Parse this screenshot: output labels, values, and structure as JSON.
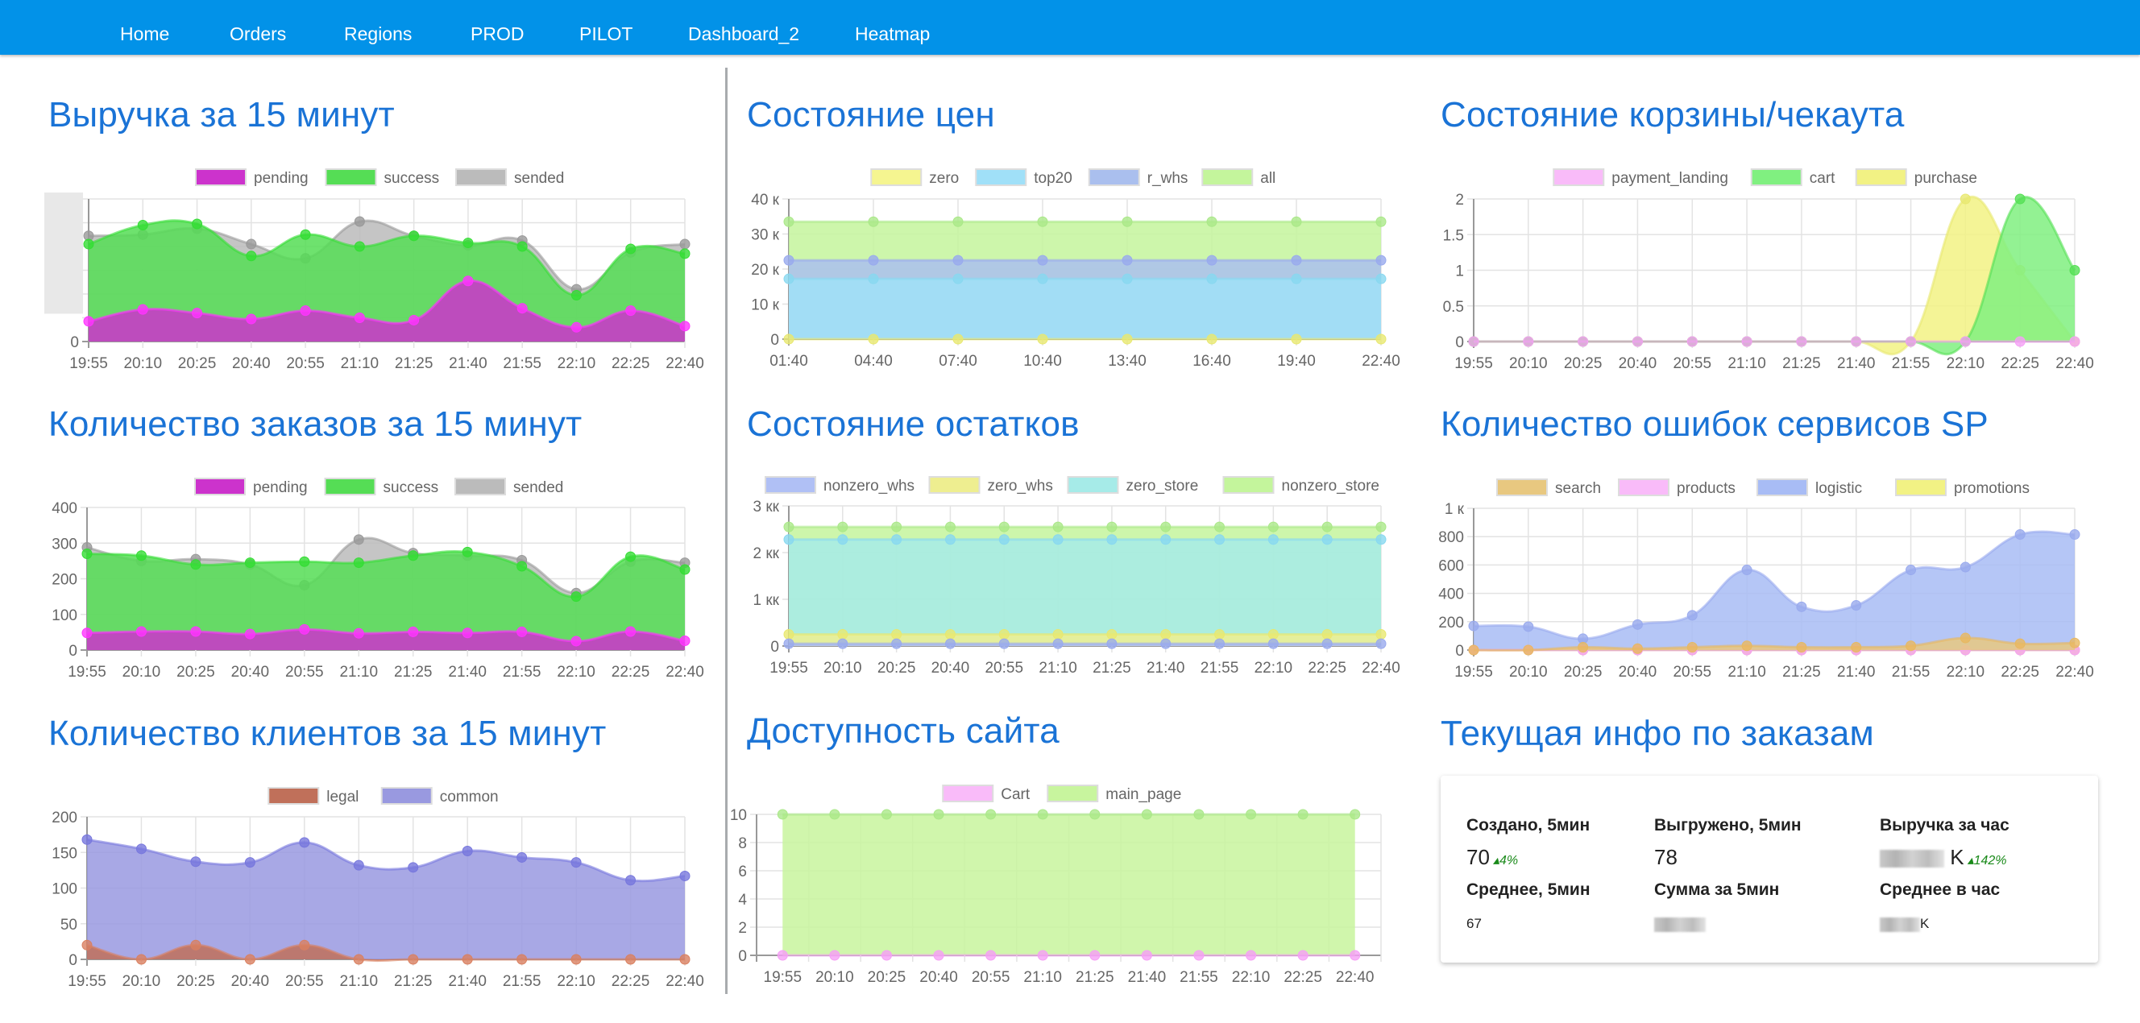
{
  "nav": {
    "items": [
      "Home",
      "Orders",
      "Regions",
      "PROD",
      "PILOT",
      "Dashboard_2",
      "Heatmap"
    ],
    "color": "#0292e8"
  },
  "titles": {
    "revenue": "Выручка за 15 минут",
    "orders": "Количество заказов за 15 минут",
    "clients": "Количество клиентов за 15 минут",
    "prices": "Состояние цен",
    "stocks": "Состояние остатков",
    "availability": "Доступность сайта",
    "cart": "Состояние корзины/чекаута",
    "errors": "Количество ошибок сервисов SP",
    "info": "Текущая инфо по заказам"
  },
  "info_card": {
    "created_label": "Создано, 5мин",
    "created_value": "70",
    "created_delta": "4%",
    "unloaded_label": "Выгружено, 5мин",
    "unloaded_value": "78",
    "revenue_hour_label": "Выручка за час",
    "revenue_hour_value_suffix": "K",
    "revenue_hour_delta": "142%",
    "avg5_label": "Среднее, 5мин",
    "avg5_value": "67",
    "sum5_label": "Сумма за 5мин",
    "avg_hour_label": "Среднее в час",
    "avg_hour_value_suffix": "K",
    "delta_color": "#1a8a1a"
  },
  "chart_data": [
    {
      "id": "revenue",
      "type": "area",
      "title": "Выручка за 15 минут",
      "categories": [
        "19:55",
        "20:10",
        "20:25",
        "20:40",
        "20:55",
        "21:10",
        "21:25",
        "21:40",
        "21:55",
        "22:10",
        "22:25",
        "22:40"
      ],
      "ylim": [
        0,
        6
      ],
      "yticks": [
        "0"
      ],
      "yticks_hidden": true,
      "grid": true,
      "legend": "top",
      "note": "y tick labels blurred; values in gridline units",
      "series": [
        {
          "name": "pending",
          "color": "#ff33ff",
          "fill": "#cc33cc",
          "values": [
            0.85,
            1.35,
            1.2,
            0.95,
            1.3,
            1.0,
            0.9,
            2.55,
            1.4,
            0.6,
            1.3,
            0.65
          ]
        },
        {
          "name": "success",
          "color": "#33dd33",
          "fill": "#55dd55",
          "values": [
            4.1,
            4.9,
            4.95,
            3.6,
            4.5,
            4.0,
            4.45,
            4.15,
            4.0,
            1.95,
            3.9,
            3.7
          ]
        },
        {
          "name": "sended",
          "color": "#999999",
          "fill": "#bbbbbb",
          "values": [
            4.45,
            4.5,
            4.75,
            4.1,
            3.5,
            5.05,
            4.45,
            4.05,
            4.25,
            2.2,
            3.75,
            4.1
          ]
        }
      ]
    },
    {
      "id": "orders",
      "type": "area",
      "title": "Количество заказов за 15 минут",
      "categories": [
        "19:55",
        "20:10",
        "20:25",
        "20:40",
        "20:55",
        "21:10",
        "21:25",
        "21:40",
        "21:55",
        "22:10",
        "22:25",
        "22:40"
      ],
      "ylim": [
        0,
        400
      ],
      "yticks": [
        "0",
        "100",
        "200",
        "300",
        "400"
      ],
      "grid": true,
      "legend": "top",
      "series": [
        {
          "name": "pending",
          "color": "#ff33ff",
          "fill": "#cc33cc",
          "values": [
            48,
            52,
            52,
            45,
            58,
            47,
            51,
            48,
            51,
            25,
            52,
            26
          ]
        },
        {
          "name": "success",
          "color": "#33dd33",
          "fill": "#55dd55",
          "values": [
            270,
            265,
            240,
            245,
            248,
            245,
            265,
            275,
            235,
            150,
            262,
            226
          ]
        },
        {
          "name": "sended",
          "color": "#999999",
          "fill": "#bbbbbb",
          "values": [
            288,
            250,
            255,
            240,
            182,
            310,
            272,
            265,
            252,
            160,
            248,
            245
          ]
        }
      ]
    },
    {
      "id": "clients",
      "type": "area",
      "title": "Количество клиентов за 15 минут",
      "categories": [
        "19:55",
        "20:10",
        "20:25",
        "20:40",
        "20:55",
        "21:10",
        "21:25",
        "21:40",
        "21:55",
        "22:10",
        "22:25",
        "22:40"
      ],
      "ylim": [
        0,
        200
      ],
      "yticks": [
        "0",
        "50",
        "100",
        "150",
        "200"
      ],
      "grid": true,
      "legend": "top",
      "series": [
        {
          "name": "legal",
          "color": "#d98060",
          "fill": "#c0705a",
          "values": [
            20,
            0,
            20,
            0,
            20,
            0,
            0,
            0,
            0,
            0,
            0,
            0
          ]
        },
        {
          "name": "common",
          "color": "#7777dd",
          "fill": "#9999e0",
          "values": [
            168,
            155,
            137,
            136,
            164,
            132,
            129,
            152,
            143,
            136,
            111,
            117
          ]
        }
      ]
    },
    {
      "id": "prices",
      "type": "area",
      "title": "Состояние цен",
      "categories": [
        "01:40",
        "04:40",
        "07:40",
        "10:40",
        "13:40",
        "16:40",
        "19:40",
        "22:40"
      ],
      "ylim": [
        0,
        40000
      ],
      "yticks": [
        "0",
        "10 к",
        "20 к",
        "30 к",
        "40 к"
      ],
      "grid": true,
      "legend": "top",
      "series": [
        {
          "name": "zero",
          "color": "#e8e870",
          "fill": "#f5f590",
          "values": [
            0,
            0,
            0,
            0,
            0,
            0,
            0,
            0
          ]
        },
        {
          "name": "top20",
          "color": "#88d8f0",
          "fill": "#a0e0f8",
          "values": [
            17200,
            17200,
            17200,
            17200,
            17200,
            17200,
            17200,
            17200
          ]
        },
        {
          "name": "r_whs",
          "color": "#99aaee",
          "fill": "#aabfee",
          "values": [
            22500,
            22500,
            22500,
            22500,
            22500,
            22500,
            22500,
            22500
          ]
        },
        {
          "name": "all",
          "color": "#aae888",
          "fill": "#c4f59c",
          "values": [
            33500,
            33500,
            33500,
            33500,
            33500,
            33500,
            33500,
            33500
          ]
        }
      ]
    },
    {
      "id": "stocks",
      "type": "area",
      "title": "Состояние остатков",
      "categories": [
        "19:55",
        "20:10",
        "20:25",
        "20:40",
        "20:55",
        "21:10",
        "21:25",
        "21:40",
        "21:55",
        "22:10",
        "22:25",
        "22:40"
      ],
      "ylim": [
        0,
        3000000
      ],
      "yticks": [
        "0",
        "1 кк",
        "2 кк",
        "3 кк"
      ],
      "grid": true,
      "legend": "top",
      "series": [
        {
          "name": "nonzero_whs",
          "color": "#99aaee",
          "fill": "#b0c0f5",
          "values": [
            50000,
            50000,
            50000,
            50000,
            50000,
            50000,
            50000,
            50000,
            50000,
            50000,
            50000,
            50000
          ]
        },
        {
          "name": "zero_whs",
          "color": "#e8e870",
          "fill": "#eeee90",
          "values": [
            250000,
            250000,
            250000,
            250000,
            250000,
            250000,
            250000,
            250000,
            250000,
            250000,
            250000,
            250000
          ]
        },
        {
          "name": "zero_store",
          "color": "#88d8f0",
          "fill": "#a6ebe8",
          "values": [
            2280000,
            2280000,
            2280000,
            2280000,
            2280000,
            2280000,
            2280000,
            2280000,
            2280000,
            2280000,
            2280000,
            2280000
          ]
        },
        {
          "name": "nonzero_store",
          "color": "#aae888",
          "fill": "#c4f59c",
          "values": [
            2550000,
            2550000,
            2550000,
            2550000,
            2550000,
            2550000,
            2550000,
            2550000,
            2550000,
            2550000,
            2550000,
            2550000
          ]
        }
      ]
    },
    {
      "id": "availability",
      "type": "area",
      "title": "Доступность сайта",
      "categories": [
        "19:55",
        "20:10",
        "20:25",
        "20:40",
        "20:55",
        "21:10",
        "21:25",
        "21:40",
        "21:55",
        "22:10",
        "22:25",
        "22:40"
      ],
      "ylim": [
        0,
        10
      ],
      "yticks": [
        "0",
        "2",
        "4",
        "6",
        "8",
        "10"
      ],
      "grid": true,
      "legend": "top",
      "offset": true,
      "series": [
        {
          "name": "Cart",
          "color": "#f5a0f5",
          "fill": "#f9bbf9",
          "values": [
            0,
            0,
            0,
            0,
            0,
            0,
            0,
            0,
            0,
            0,
            0,
            0
          ],
          "hidden_area": true
        },
        {
          "name": "main_page",
          "color": "#aae888",
          "fill": "#c8f59e",
          "values": [
            10,
            10,
            10,
            10,
            10,
            10,
            10,
            10,
            10,
            10,
            10,
            10
          ]
        }
      ]
    },
    {
      "id": "cart",
      "type": "area",
      "title": "Состояние корзины/чекаута",
      "categories": [
        "19:55",
        "20:10",
        "20:25",
        "20:40",
        "20:55",
        "21:10",
        "21:25",
        "21:40",
        "21:55",
        "22:10",
        "22:25",
        "22:40"
      ],
      "ylim": [
        0,
        2
      ],
      "yticks": [
        "0",
        "0.5",
        "1",
        "1.5",
        "2"
      ],
      "grid": true,
      "legend": "top",
      "series": [
        {
          "name": "payment_landing",
          "color": "#f5a0f5",
          "fill": "#f9bbf9",
          "values": [
            0,
            0,
            0,
            0,
            0,
            0,
            0,
            0,
            0,
            0,
            0,
            0
          ]
        },
        {
          "name": "cart",
          "color": "#55e055",
          "fill": "#80f080",
          "values": [
            0,
            0,
            0,
            0,
            0,
            0,
            0,
            0,
            0,
            0,
            2,
            1
          ]
        },
        {
          "name": "purchase",
          "color": "#e8e870",
          "fill": "#f2f284",
          "values": [
            0,
            0,
            0,
            0,
            0,
            0,
            0,
            0,
            0,
            2,
            1,
            0
          ]
        }
      ]
    },
    {
      "id": "errors",
      "type": "area",
      "title": "Количество ошибок сервисов SP",
      "categories": [
        "19:55",
        "20:10",
        "20:25",
        "20:40",
        "20:55",
        "21:10",
        "21:25",
        "21:40",
        "21:55",
        "22:10",
        "22:25",
        "22:40"
      ],
      "ylim": [
        0,
        1000
      ],
      "yticks": [
        "0",
        "200",
        "400",
        "600",
        "800",
        "1 к"
      ],
      "grid": true,
      "legend": "top",
      "series": [
        {
          "name": "search",
          "color": "#e8b860",
          "fill": "#e8c880",
          "values": [
            0,
            0,
            20,
            10,
            20,
            30,
            20,
            20,
            30,
            85,
            45,
            50
          ]
        },
        {
          "name": "products",
          "color": "#f5a0f5",
          "fill": "#f9bbf9",
          "values": [
            0,
            0,
            0,
            0,
            0,
            0,
            0,
            0,
            0,
            0,
            0,
            0
          ]
        },
        {
          "name": "logistic",
          "color": "#99aaee",
          "fill": "#a8bcf5",
          "values": [
            170,
            165,
            80,
            180,
            245,
            565,
            305,
            315,
            565,
            585,
            815,
            815
          ]
        },
        {
          "name": "promotions",
          "color": "#e8e870",
          "fill": "#f2f284",
          "values": [
            0,
            0,
            0,
            0,
            0,
            0,
            0,
            0,
            0,
            0,
            0,
            0
          ]
        }
      ]
    }
  ]
}
